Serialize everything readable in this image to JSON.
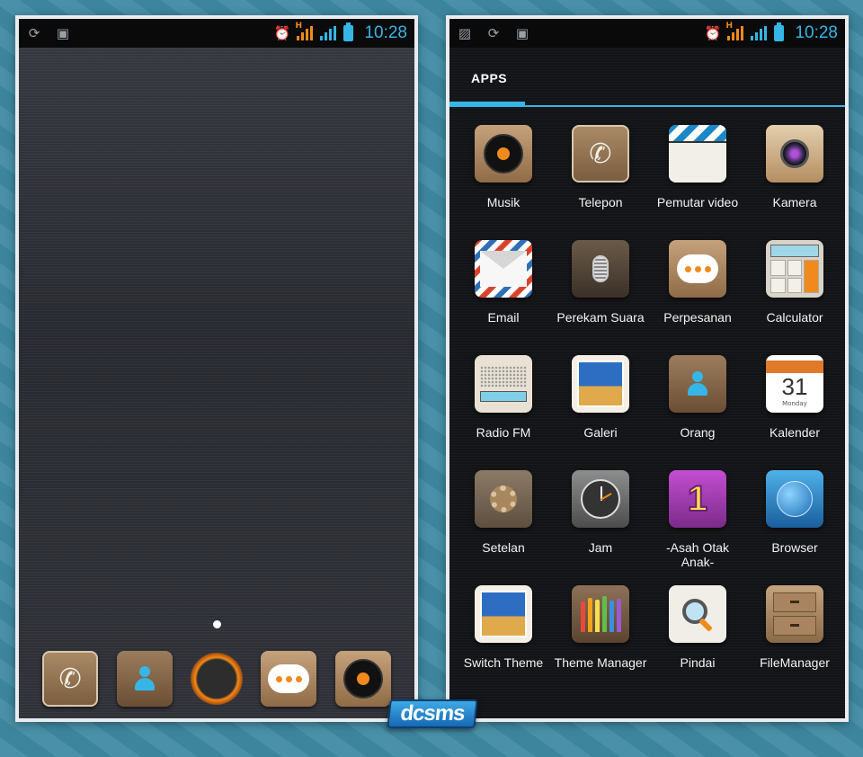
{
  "status_bar": {
    "time": "10:28",
    "network_label": "H"
  },
  "home": {
    "dock": [
      {
        "name": "phone-app-icon"
      },
      {
        "name": "contacts-app-icon"
      },
      {
        "name": "app-drawer-launcher-icon"
      },
      {
        "name": "messaging-app-icon"
      },
      {
        "name": "music-app-icon"
      }
    ]
  },
  "apps_drawer": {
    "tab_label": "APPS",
    "apps": [
      {
        "label": "Musik",
        "icon": "music-icon"
      },
      {
        "label": "Telepon",
        "icon": "phone-icon"
      },
      {
        "label": "Pemutar video",
        "icon": "video-player-icon"
      },
      {
        "label": "Kamera",
        "icon": "camera-icon"
      },
      {
        "label": "Email",
        "icon": "email-icon"
      },
      {
        "label": "Perekam Suara",
        "icon": "voice-recorder-icon"
      },
      {
        "label": "Perpesanan",
        "icon": "messaging-icon"
      },
      {
        "label": "Calculator",
        "icon": "calculator-icon"
      },
      {
        "label": "Radio FM",
        "icon": "radio-icon"
      },
      {
        "label": "Galeri",
        "icon": "gallery-icon"
      },
      {
        "label": "Orang",
        "icon": "contacts-icon"
      },
      {
        "label": "Kalender",
        "icon": "calendar-icon"
      },
      {
        "label": "Setelan",
        "icon": "settings-icon"
      },
      {
        "label": "Jam",
        "icon": "clock-icon"
      },
      {
        "label": "-Asah Otak Anak-",
        "icon": "kids-game-icon"
      },
      {
        "label": "Browser",
        "icon": "browser-icon"
      },
      {
        "label": "Switch Theme",
        "icon": "switch-theme-icon"
      },
      {
        "label": "Theme Manager",
        "icon": "theme-manager-icon"
      },
      {
        "label": "Pindai",
        "icon": "scan-icon"
      },
      {
        "label": "FileManager",
        "icon": "file-manager-icon"
      }
    ],
    "calendar_icon": {
      "day_number": "31",
      "day_name": "Monday"
    }
  },
  "watermark": "dcsms",
  "colors": {
    "accent": "#35b6e6",
    "orange": "#f08a1c",
    "background": "#3f8aa3"
  }
}
